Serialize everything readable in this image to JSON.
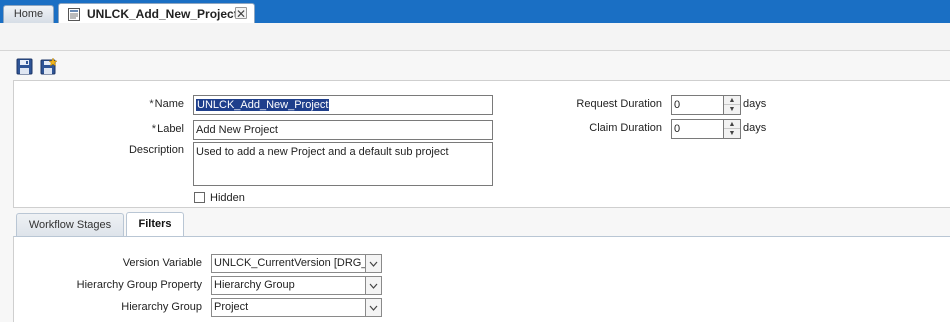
{
  "tabs": {
    "home_label": "Home",
    "active_label": "UNLCK_Add_New_Project",
    "close_glyph": "✕"
  },
  "toolbar": {
    "save_icon": "save-icon",
    "save_as_icon": "save-new-icon"
  },
  "form": {
    "required_mark": "*",
    "name_label": "Name",
    "name_value": "UNLCK_Add_New_Project",
    "label_label": "Label",
    "label_value": "Add New Project",
    "description_label": "Description",
    "description_value": "Used to add a new Project and a default sub project",
    "hidden_label": "Hidden",
    "hidden_checked": false,
    "request_duration_label": "Request Duration",
    "request_duration_value": "0",
    "claim_duration_label": "Claim Duration",
    "claim_duration_value": "0",
    "days_label": "days"
  },
  "subtabs": {
    "workflow_stages": "Workflow Stages",
    "filters": "Filters"
  },
  "filters": {
    "version_variable_label": "Version Variable",
    "version_variable_value": "UNLCK_CurrentVersion [DRG_W",
    "hierarchy_group_property_label": "Hierarchy Group Property",
    "hierarchy_group_property_value": "Hierarchy Group",
    "hierarchy_group_label": "Hierarchy Group",
    "hierarchy_group_value": "Project"
  },
  "colors": {
    "tabbar": "#1a6fc4",
    "selection": "#1f3f8c"
  }
}
